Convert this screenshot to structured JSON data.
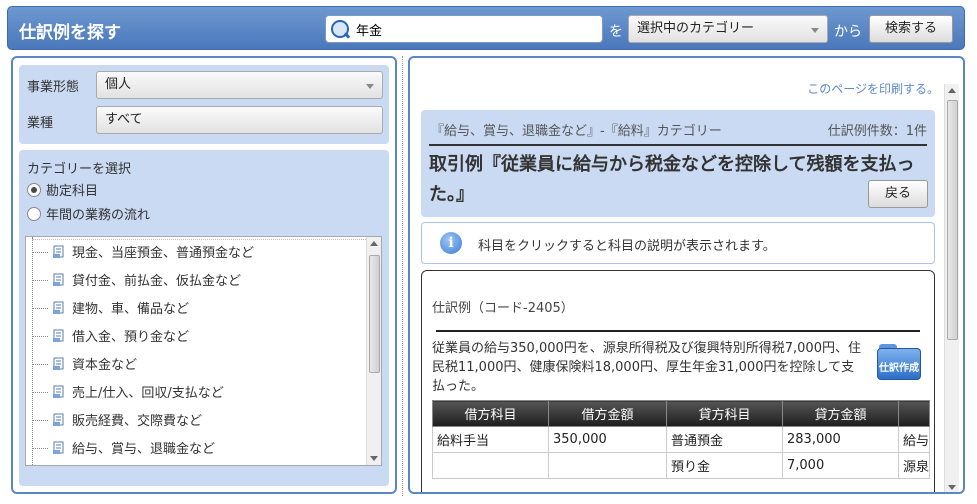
{
  "header": {
    "title": "仕訳例を探す",
    "search_value": "年金",
    "wo_label": "を",
    "category_select": "選択中のカテゴリー",
    "kara_label": "から",
    "search_button": "検索する"
  },
  "left": {
    "business_type_label": "事業形態",
    "business_type_value": "個人",
    "industry_label": "業種",
    "industry_value": "すべて",
    "category_heading": "カテゴリーを選択",
    "radio_options": [
      {
        "label": "勘定科目",
        "selected": true
      },
      {
        "label": "年間の業務の流れ",
        "selected": false
      }
    ],
    "tree_items": [
      "現金、当座預金、普通預金など",
      "貸付金、前払金、仮払金など",
      "建物、車、備品など",
      "借入金、預り金など",
      "資本金など",
      "売上/仕入、回収/支払など",
      "販売経費、交際費など",
      "給与、賞与、退職金など"
    ]
  },
  "right": {
    "print_link": "このページを印刷する。",
    "category_path": "『給与、賞与、退職金など』-『給料』カテゴリー",
    "example_count": "仕訳例件数：1件",
    "transaction_title": "取引例『従業員に給与から税金などを控除して残額を支払った。』",
    "back_button": "戻る",
    "info_message": "科目をクリックすると科目の説明が表示されます。",
    "example_code": "仕訳例（コード-2405）",
    "example_desc": "従業員の給与350,000円を、源泉所得税及び復興特別所得税7,000円、住民税11,000円、健康保険料18,000円、厚生年金31,000円を控除して支払った。",
    "create_icon_label": "仕訳作成",
    "table": {
      "headers": [
        "借方科目",
        "借方金額",
        "貸方科目",
        "貸方金額",
        ""
      ],
      "rows": [
        [
          "給料手当",
          "350,000",
          "普通預金",
          "283,000",
          "給与"
        ],
        [
          "",
          "",
          "預り金",
          "7,000",
          "源泉"
        ]
      ]
    }
  },
  "colors": {
    "header_bg": "#4a78bb",
    "panel_border": "#5b87c5",
    "panel_fill": "#c9daf2",
    "link": "#5b8ad0"
  }
}
